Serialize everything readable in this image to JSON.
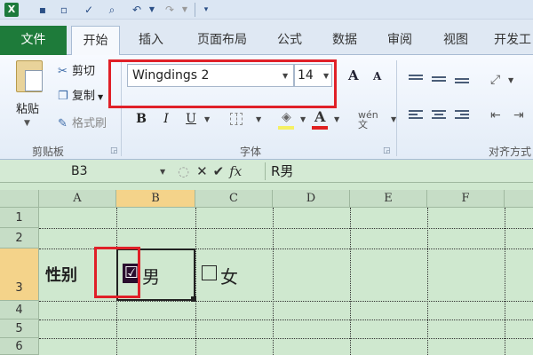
{
  "app": {
    "logo_text": "X",
    "qat_items": [
      "save-icon",
      "new-icon",
      "spell-check-icon",
      "print-preview-icon",
      "undo-icon",
      "redo-icon",
      "customize-icon"
    ]
  },
  "tabs": {
    "file": "文件",
    "items": [
      "开始",
      "插入",
      "页面布局",
      "公式",
      "数据",
      "审阅",
      "视图",
      "开发工"
    ],
    "active": "开始"
  },
  "ribbon": {
    "clipboard": {
      "paste": "粘贴",
      "cut": "剪切",
      "copy": "复制",
      "format_painter": "格式刷",
      "label": "剪贴板"
    },
    "font": {
      "name": "Wingdings 2",
      "size": "14",
      "grow": "A",
      "shrink": "A",
      "bold": "B",
      "italic": "I",
      "underline": "U",
      "font_color": "A",
      "phonetic": "wén 文",
      "label": "字体"
    },
    "alignment": {
      "label": "对齐方式"
    }
  },
  "formula_bar": {
    "name_box": "B3",
    "cancel": "✕",
    "enter": "✔",
    "fx": "fx",
    "content": "R男"
  },
  "grid": {
    "columns": [
      "A",
      "B",
      "C",
      "D",
      "E",
      "F"
    ],
    "rows": [
      "1",
      "2",
      "3",
      "4",
      "5",
      "6"
    ],
    "selected_cell": "B3",
    "cells": {
      "A3": "性别",
      "B3_symbol": "☑",
      "B3_text": "男",
      "C3_text": "女"
    }
  },
  "colors": {
    "file_tab": "#1e7b3a",
    "sheet_bg": "#cfe8cf",
    "highlight_frame": "#e02028",
    "selected_header": "#f4d38a"
  }
}
